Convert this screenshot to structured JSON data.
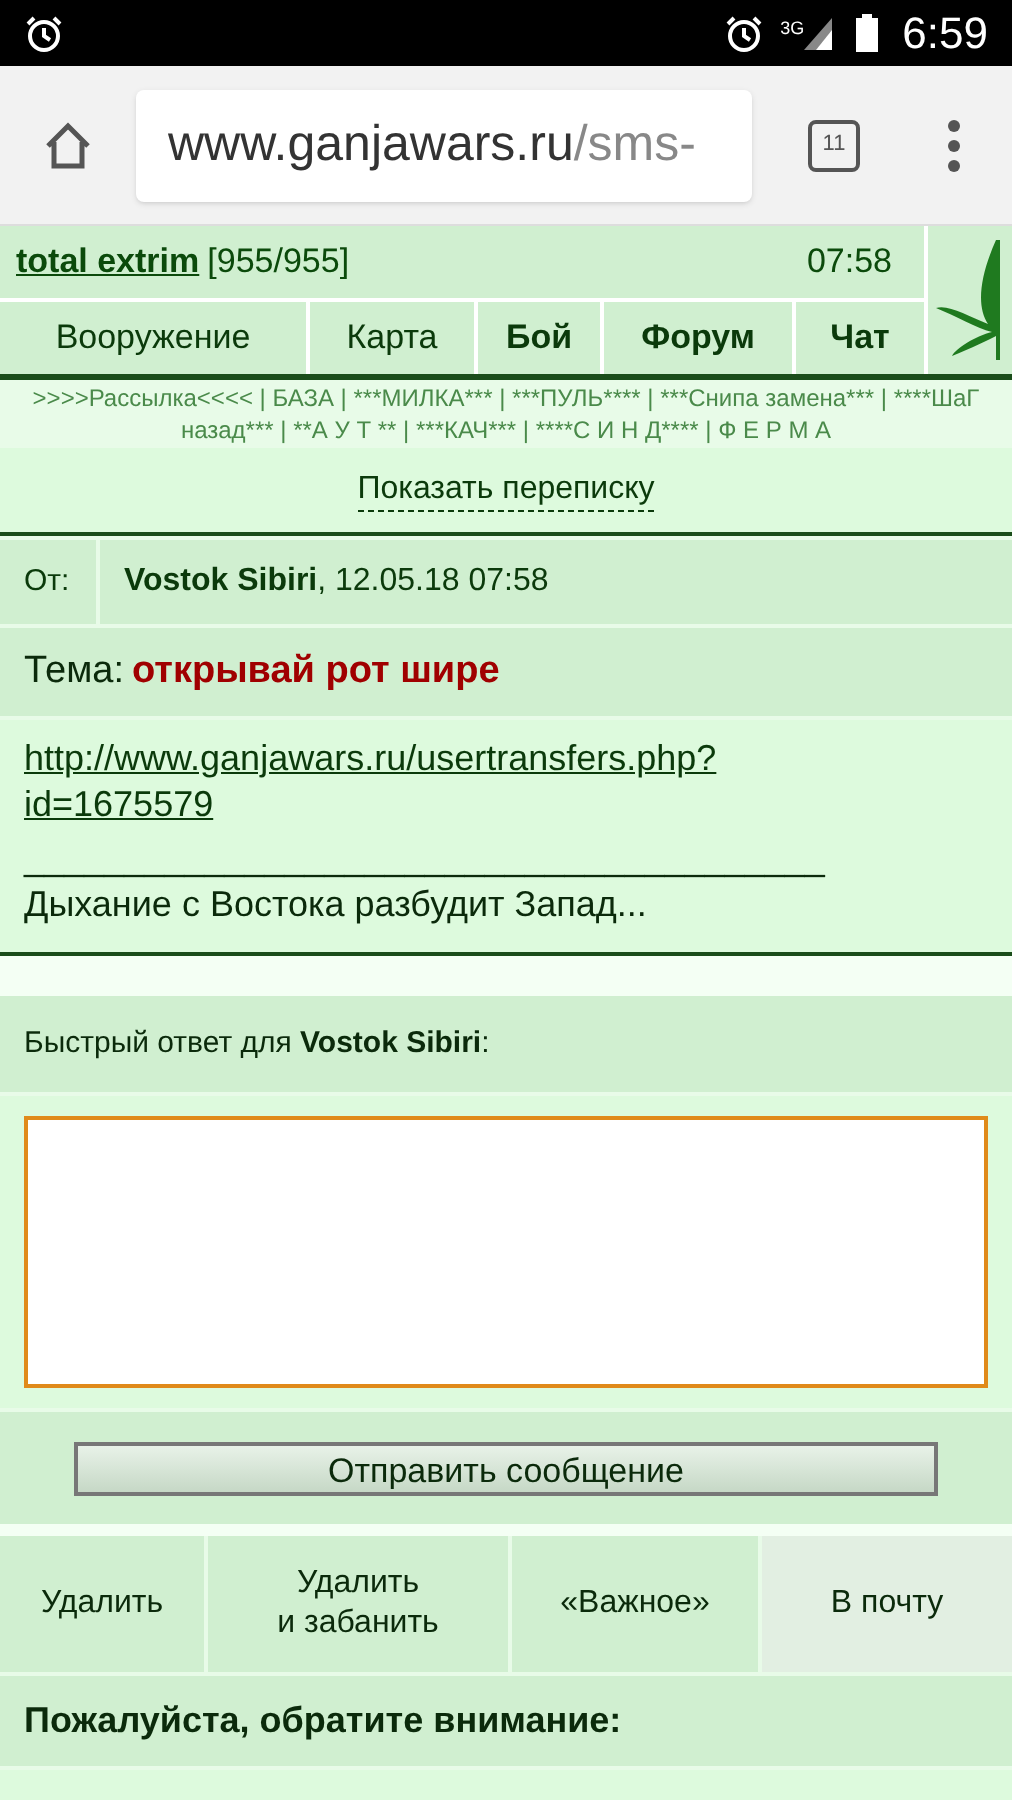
{
  "status_bar": {
    "time": "6:59",
    "network": "3G"
  },
  "browser": {
    "url_host": "www.ganjawars.ru",
    "url_path": "/sms-",
    "tab_count": "11"
  },
  "header": {
    "user": "total extrim",
    "hp": "[955/955]",
    "time": "07:58"
  },
  "nav": [
    {
      "label": "Вооружение",
      "bold": false
    },
    {
      "label": "Карта",
      "bold": false
    },
    {
      "label": "Бой",
      "bold": true
    },
    {
      "label": "Форум",
      "bold": true
    },
    {
      "label": "Чат",
      "bold": true
    }
  ],
  "links_text": ">>>>Рассылка<<<< | БАЗА | ***МИЛКА*** | ***ПУЛЬ**** | ***Снипа замена*** | ****ШаГ назад*** | **А У Т ** | ***КАЧ*** | ****С И Н Д**** | Ф Е Р М А",
  "show_thread": "Показать переписку",
  "message": {
    "from_label": "От:",
    "sender": "Vostok Sibiri",
    "date": ", 12.05.18 07:58",
    "subject_label": "Тема:",
    "subject": "открывай рот шире",
    "link": "http://www.ganjawars.ru/usertransfers.php?id=1675579",
    "rule": "________________________________________",
    "body": "Дыхание с Востока разбудит Запад..."
  },
  "reply": {
    "label": "Быстрый ответ для **Vostok Sibiri**:",
    "focused": true,
    "send": "Отправить сообщение"
  },
  "actions": [
    {
      "label": "Удалить",
      "selected": false
    },
    {
      "label": "Удалить\nи забанить",
      "selected": false
    },
    {
      "label": "«Важное»",
      "selected": false
    },
    {
      "label": "В почту",
      "selected": true
    }
  ],
  "notice": {
    "title": "Пожалуйста, обратите внимание:"
  }
}
